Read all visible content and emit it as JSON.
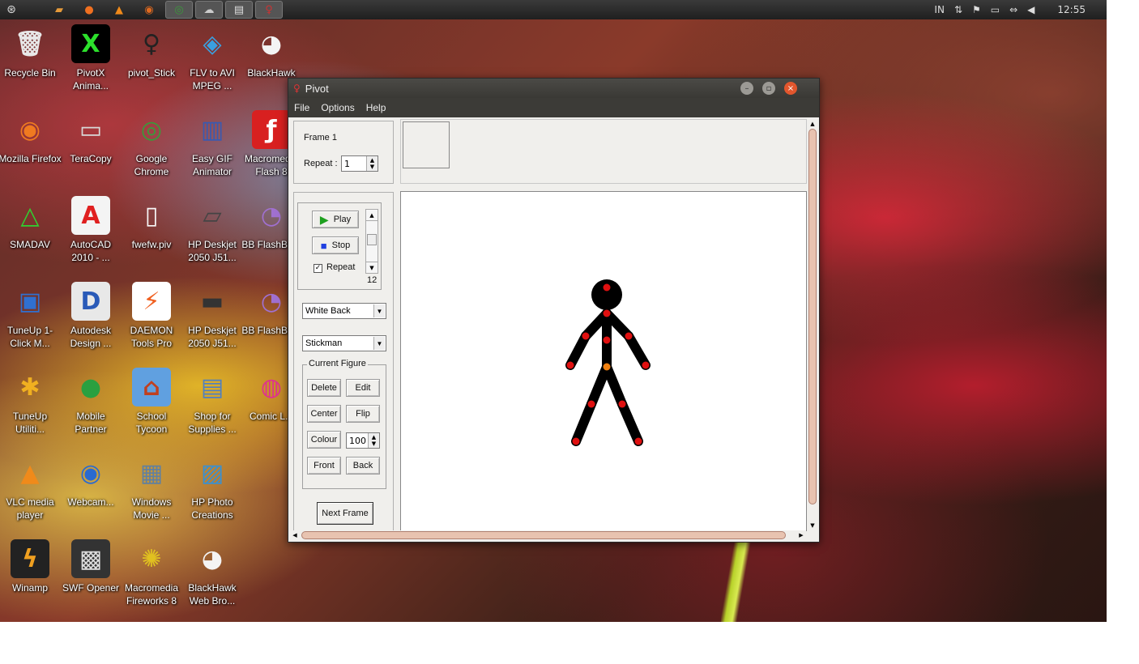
{
  "panel": {
    "apps": [
      "home",
      "folder",
      "ubuntu-one",
      "vlc",
      "firefox",
      "chrome",
      "pidgin",
      "files",
      "pivot"
    ],
    "tray": {
      "indicator": "IN",
      "clock": "12:55"
    }
  },
  "desktop_icons": [
    {
      "label": "Recycle Bin",
      "icon": "recycle-bin-icon"
    },
    {
      "label": "PivotX Anima...",
      "icon": "pivotx-icon"
    },
    {
      "label": "pivot_Stick",
      "icon": "stick-figure-icon"
    },
    {
      "label": "FLV to AVI MPEG ...",
      "icon": "flv-converter-icon"
    },
    {
      "label": "BlackHawk",
      "icon": "eagle-icon"
    },
    {
      "label": "Mozilla Firefox",
      "icon": "firefox-icon"
    },
    {
      "label": "TeraCopy",
      "icon": "teracopy-icon"
    },
    {
      "label": "Google Chrome",
      "icon": "chrome-icon"
    },
    {
      "label": "Easy GIF Animator",
      "icon": "film-icon"
    },
    {
      "label": "Macromedia Flash 8",
      "icon": "flash-icon"
    },
    {
      "label": "SMADAV",
      "icon": "smadav-icon"
    },
    {
      "label": "AutoCAD 2010 - ...",
      "icon": "autocad-icon"
    },
    {
      "label": "fwefw.piv",
      "icon": "file-icon"
    },
    {
      "label": "HP Deskjet 2050 J51...",
      "icon": "scanner-icon"
    },
    {
      "label": "BB FlashBa...",
      "icon": "bb-flashback-icon"
    },
    {
      "label": "TuneUp 1-Click M...",
      "icon": "tuneup-icon"
    },
    {
      "label": "Autodesk Design ...",
      "icon": "autodesk-icon"
    },
    {
      "label": "DAEMON Tools Pro",
      "icon": "daemon-icon"
    },
    {
      "label": "HP Deskjet 2050 J51...",
      "icon": "printer-icon"
    },
    {
      "label": "BB FlashBa...",
      "icon": "bb-flashback-icon"
    },
    {
      "label": "TuneUp Utiliti...",
      "icon": "tuneup-utilities-icon"
    },
    {
      "label": "Mobile Partner",
      "icon": "mobile-partner-icon"
    },
    {
      "label": "School Tycoon",
      "icon": "school-icon"
    },
    {
      "label": "Shop for Supplies ...",
      "icon": "shop-icon"
    },
    {
      "label": "Comic L...",
      "icon": "comic-life-icon"
    },
    {
      "label": "VLC media player",
      "icon": "vlc-icon"
    },
    {
      "label": "Webcam...",
      "icon": "webcam-icon"
    },
    {
      "label": "Windows Movie ...",
      "icon": "movie-icon"
    },
    {
      "label": "HP Photo Creations",
      "icon": "photo-icon"
    },
    {
      "label": "Winamp",
      "icon": "winamp-icon"
    },
    {
      "label": "SWF Opener",
      "icon": "swf-icon"
    },
    {
      "label": "Macromedia Fireworks 8",
      "icon": "fireworks-icon"
    },
    {
      "label": "BlackHawk Web Bro...",
      "icon": "eagle-icon"
    }
  ],
  "window": {
    "title": "Pivot",
    "menu": [
      "File",
      "Options",
      "Help"
    ],
    "frame_label": "Frame 1",
    "repeat_label": "Repeat :",
    "repeat_value": "1",
    "play_label": "Play",
    "stop_label": "Stop",
    "repeat_checkbox_label": "Repeat",
    "repeat_checked": true,
    "speed_value": "12",
    "background_select": "White Back",
    "figure_select": "Stickman",
    "current_figure_label": "Current Figure",
    "delete_label": "Delete",
    "edit_label": "Edit",
    "center_label": "Center",
    "flip_label": "Flip",
    "colour_label": "Colour",
    "size_value": "100",
    "front_label": "Front",
    "back_label": "Back",
    "next_frame_label": "Next Frame"
  },
  "colors": {
    "joint": "#e01010",
    "center_joint": "#f08010",
    "figure": "#000000",
    "scroll_thumb": "#e8c3b0"
  }
}
